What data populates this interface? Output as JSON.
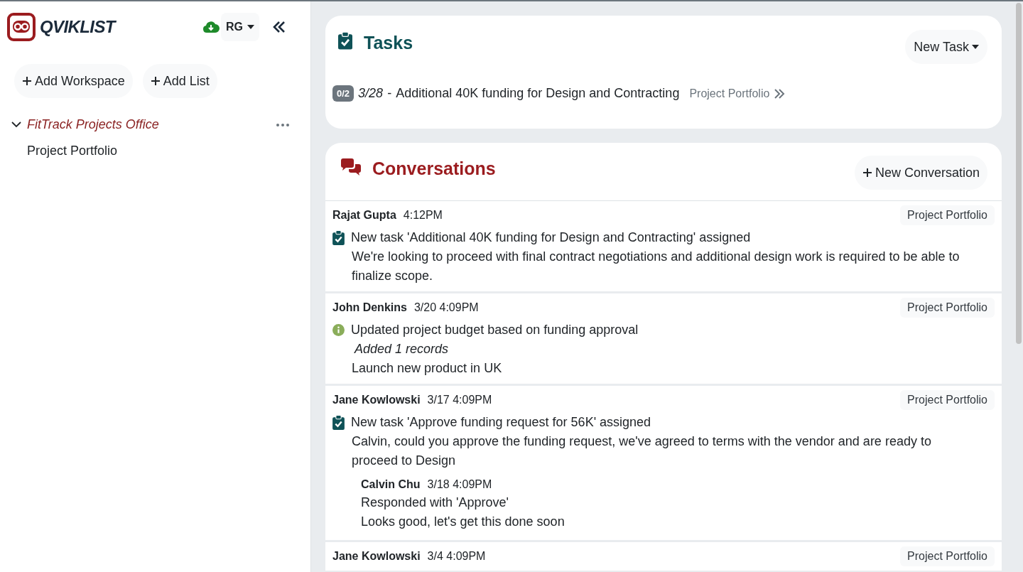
{
  "sidebar": {
    "logo": "QVIKLIST",
    "user": "RG",
    "buttons": [
      "Add Workspace",
      "Add List"
    ],
    "workspaces": [
      {
        "name": "FitTrack Projects Office",
        "expanded": true,
        "children": [
          {
            "name": "Project Portfolio"
          }
        ]
      }
    ]
  },
  "tasks": {
    "title": "Tasks",
    "new_button": "New Task",
    "items": [
      {
        "progress": "0/2",
        "date": "3/28",
        "separator": "-",
        "title": "Additional 40K funding for Design and Contracting",
        "list": "Project Portfolio"
      }
    ]
  },
  "conversations": {
    "title": "Conversations",
    "new_button": "New Conversation",
    "messages": [
      {
        "author": "Rajat Gupta",
        "time": "4:12PM",
        "tag": "Project Portfolio",
        "kind": "task",
        "title": "New task 'Additional 40K funding for Design and Contracting' assigned",
        "lines": [
          {
            "text": "We're looking to proceed with final contract negotiations and additional design work is required to be able to finalize scope.",
            "italic": false
          }
        ]
      },
      {
        "author": "John Denkins",
        "time": "3/20 4:09PM",
        "tag": "Project Portfolio",
        "kind": "info",
        "title": "Updated project budget based on funding approval",
        "lines": [
          {
            "text": "Added 1 records",
            "italic": true
          },
          {
            "text": "Launch new product in UK",
            "italic": false
          }
        ]
      },
      {
        "author": "Jane Kowlowski",
        "time": "3/17 4:09PM",
        "tag": "Project Portfolio",
        "kind": "task",
        "title": "New task 'Approve funding request for 56K' assigned",
        "lines": [
          {
            "text": "Calvin, could you approve the funding request, we've agreed to terms with the vendor and are ready to proceed to Design",
            "italic": false
          }
        ],
        "replies": [
          {
            "author": "Calvin Chu",
            "time": "3/18 4:09PM",
            "lines": [
              "Responded with 'Approve'",
              "Looks good, let's get this done soon"
            ]
          }
        ]
      },
      {
        "author": "Jane Kowlowski",
        "time": "3/4 4:09PM",
        "tag": "Project Portfolio"
      }
    ]
  }
}
